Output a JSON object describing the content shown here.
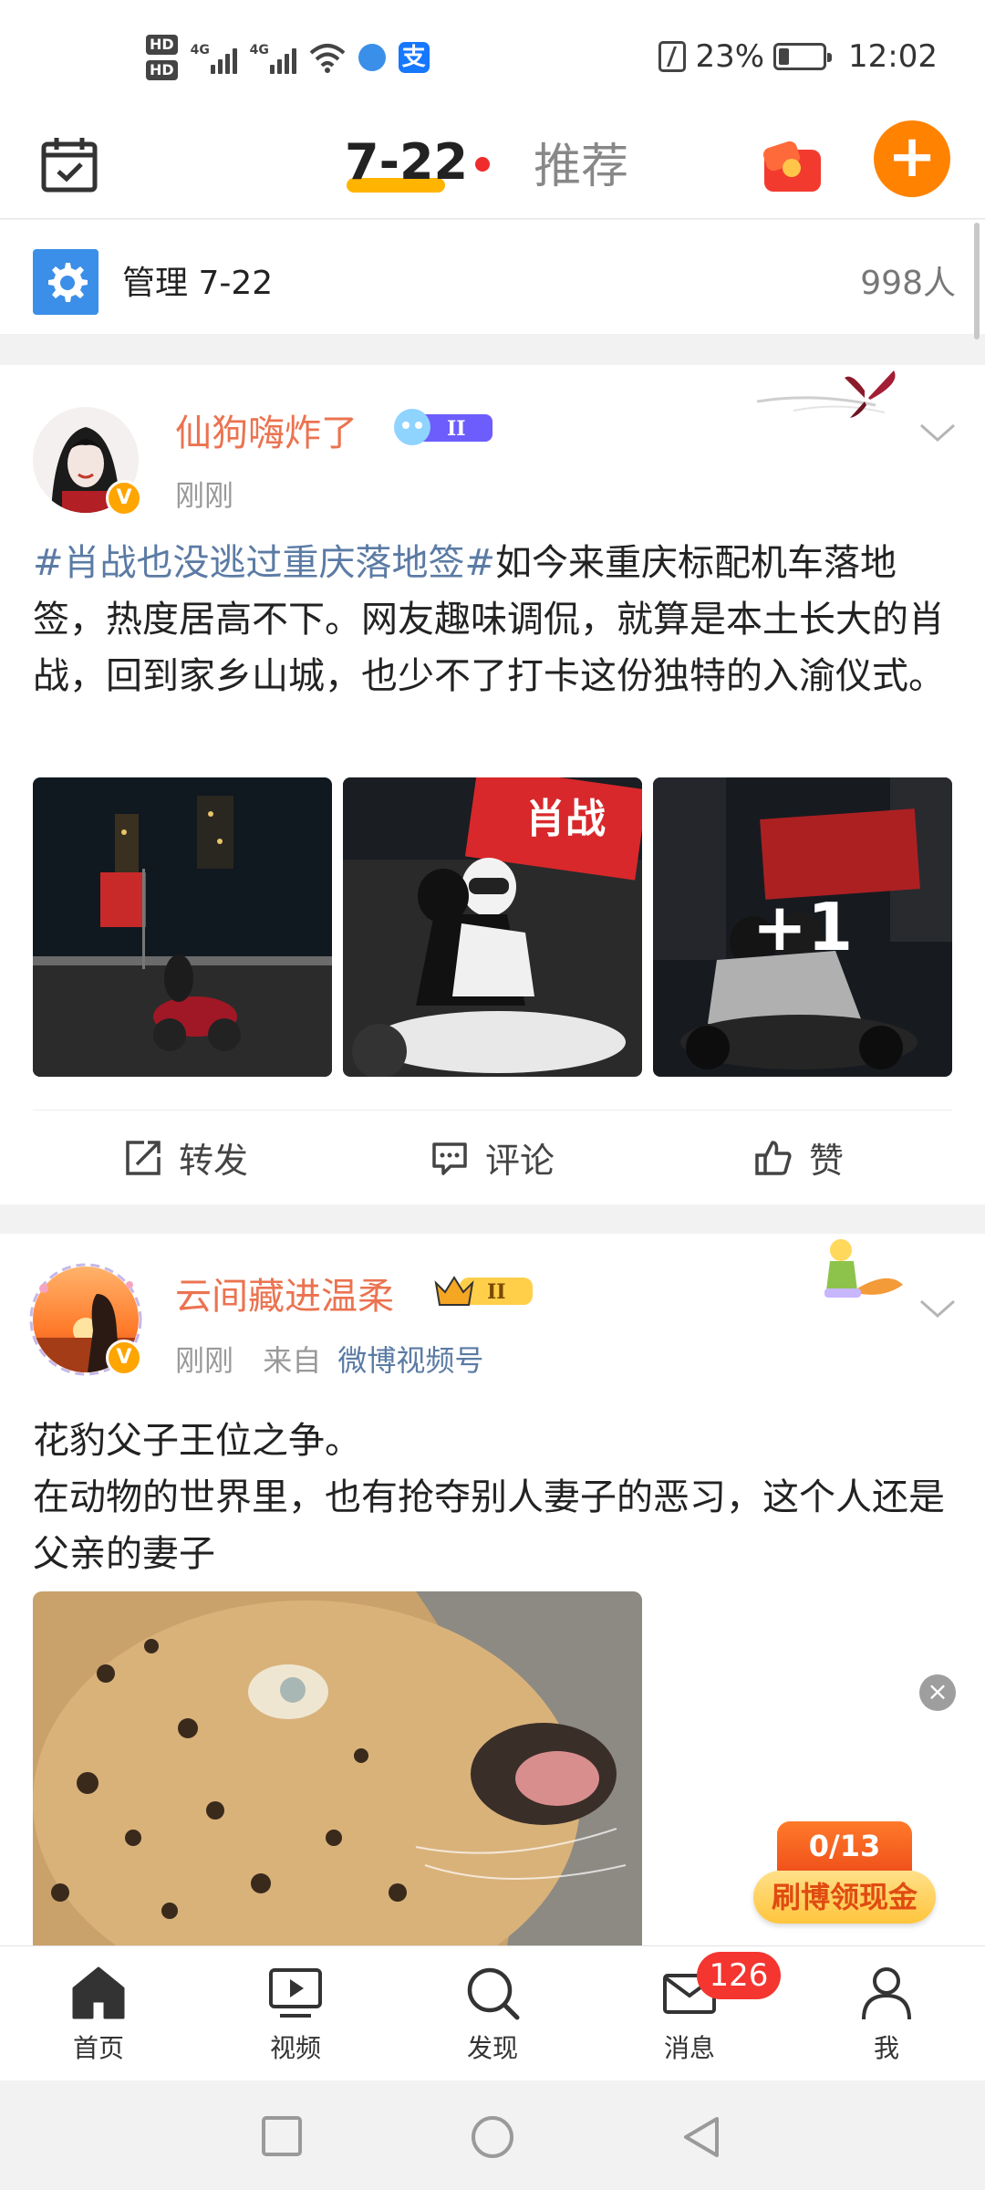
{
  "status_bar": {
    "battery": "23%",
    "time": "12:02",
    "network_1": "4G",
    "network_2": "4G",
    "hd1": "HD",
    "hd2": "HD",
    "alipay_glyph": "支"
  },
  "top_nav": {
    "active_tab": "7-22",
    "inactive_tab": "推荐",
    "plus_label": "+"
  },
  "group_bar": {
    "name": "管理 7-22",
    "member_count": "998人"
  },
  "posts": [
    {
      "username": "仙狗嗨炸了",
      "time": "刚刚",
      "verified": "V",
      "topic": "#肖战也没逃过重庆落地签#",
      "text": "如今来重庆标配机车落地签，热度居高不下。网友趣味调侃，就算是本土长大的肖战，回到家乡山城，也少不了打卡这份独特的入渝仪式。",
      "more_images": "+1",
      "actions": {
        "repost": "转发",
        "comment": "评论",
        "like": "赞"
      },
      "flag_text": "肖战"
    },
    {
      "username": "云间藏进温柔",
      "time": "刚刚",
      "from_label": "来自",
      "source": "微博视频号",
      "verified": "V",
      "text_line1": "花豹父子王位之争。",
      "text_line2": "在动物的世界里，也有抢夺别人妻子的恶习，这个人还是父亲的妻子"
    }
  ],
  "reward": {
    "progress": "0/13",
    "label": "刷博领现金"
  },
  "tab_bar": {
    "items": [
      {
        "label": "首页"
      },
      {
        "label": "视频"
      },
      {
        "label": "发现"
      },
      {
        "label": "消息"
      },
      {
        "label": "我"
      }
    ],
    "message_badge": "126"
  },
  "colors": {
    "accent": "#ff8200",
    "username": "#eb7350",
    "topic_link": "#5b7ba4",
    "tab_underline": "#ffb400",
    "badge_red": "#f43530"
  }
}
